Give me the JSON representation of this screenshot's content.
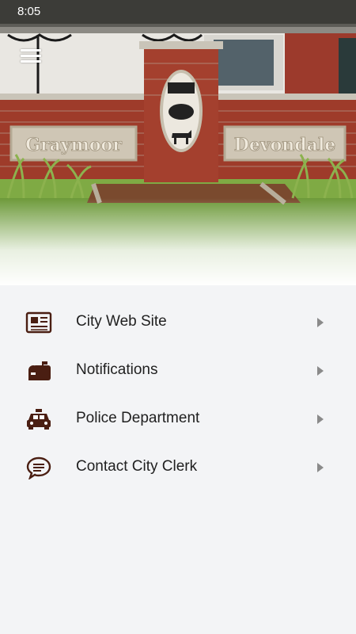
{
  "status_bar": {
    "time": "8:05"
  },
  "hero": {
    "sign_left_text": "Graymoor",
    "sign_right_text": "Devondale"
  },
  "menu": {
    "icon_color": "#4a1e12",
    "items": [
      {
        "label": "City Web Site",
        "icon": "newspaper-icon"
      },
      {
        "label": "Notifications",
        "icon": "mailbox-icon"
      },
      {
        "label": "Police Department",
        "icon": "police-car-icon"
      },
      {
        "label": "Contact City Clerk",
        "icon": "chat-bubble-icon"
      }
    ]
  }
}
